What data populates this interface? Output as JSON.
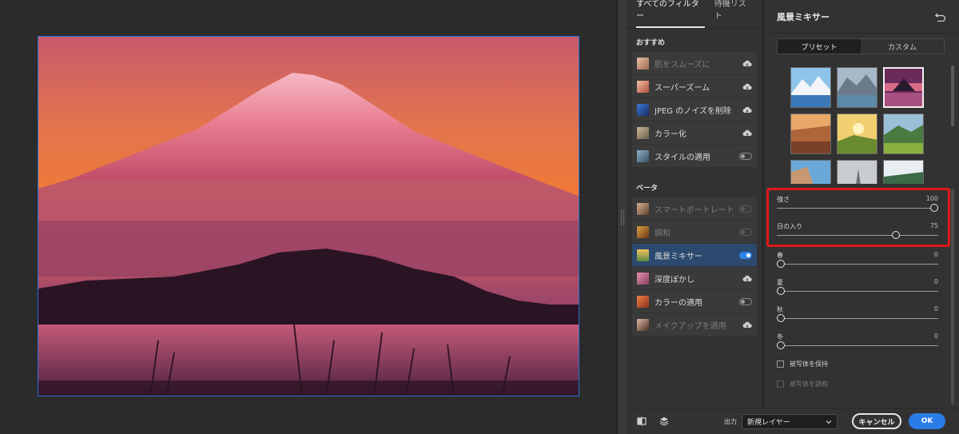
{
  "filters_panel": {
    "tabs": [
      {
        "label": "すべてのフィルター",
        "active": true
      },
      {
        "label": "待機リスト",
        "active": false
      }
    ],
    "groups": [
      {
        "title": "おすすめ",
        "items": [
          {
            "label": "肌をスムーズに",
            "control": "cloud",
            "disabled": true
          },
          {
            "label": "スーパーズーム",
            "control": "cloud",
            "disabled": false
          },
          {
            "label": "JPEG のノイズを削除",
            "control": "cloud",
            "disabled": false
          },
          {
            "label": "カラー化",
            "control": "cloud",
            "disabled": false
          },
          {
            "label": "スタイルの適用",
            "control": "toggle-off",
            "disabled": false
          }
        ]
      },
      {
        "title": "ベータ",
        "items": [
          {
            "label": "スマートポートレート",
            "control": "toggle-dim",
            "disabled": true
          },
          {
            "label": "調和",
            "control": "toggle-dim",
            "disabled": true
          },
          {
            "label": "風景ミキサー",
            "control": "toggle-on",
            "disabled": false,
            "selected": true
          },
          {
            "label": "深度ぼかし",
            "control": "cloud",
            "disabled": false
          },
          {
            "label": "カラーの適用",
            "control": "toggle-off",
            "disabled": false
          },
          {
            "label": "メイクアップを適用",
            "control": "cloud",
            "disabled": true
          }
        ]
      }
    ]
  },
  "settings": {
    "title": "風景ミキサー",
    "segments": [
      {
        "label": "プリセット",
        "active": true
      },
      {
        "label": "カスタム",
        "active": false
      }
    ],
    "sliders": [
      {
        "label": "強さ",
        "value": 100,
        "max": 100
      },
      {
        "label": "日の入り",
        "value": 75,
        "max": 100
      },
      {
        "label": "春",
        "value": 0,
        "max": 100
      },
      {
        "label": "夏",
        "value": 0,
        "max": 100
      },
      {
        "label": "秋",
        "value": 0,
        "max": 100
      },
      {
        "label": "冬",
        "value": 0,
        "max": 100
      }
    ],
    "checkboxes": [
      {
        "label": "被写体を保持",
        "checked": false,
        "disabled": false
      },
      {
        "label": "被写体を調和",
        "checked": false,
        "disabled": true
      }
    ]
  },
  "bottom_bar": {
    "output_label": "出力",
    "output_value": "新規レイヤー",
    "cancel_label": "キャンセル",
    "ok_label": "OK"
  },
  "colors": {
    "accent": "#2a7ce6",
    "highlight": "#e01818",
    "selected_item": "#2c4a6f"
  }
}
